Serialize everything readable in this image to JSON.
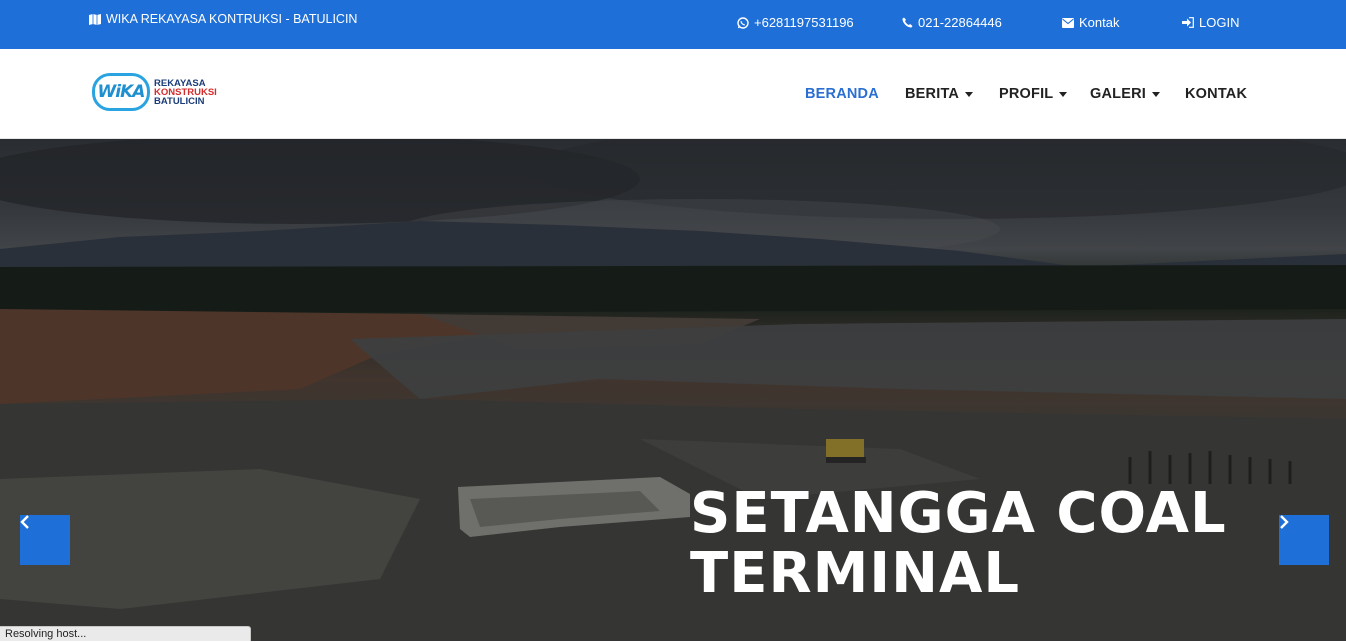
{
  "topbar": {
    "site_name": "WIKA REKAYASA KONTRUKSI - BATULICIN",
    "whatsapp": "+6281197531196",
    "phone": "021-22864446",
    "contact": "Kontak",
    "login": "LOGIN"
  },
  "logo": {
    "mark": "WiKA",
    "line1": "REKAYASA",
    "line2": "KONSTRUKSI",
    "line3": "BATULICIN"
  },
  "nav": {
    "items": [
      {
        "label": "BERANDA",
        "active": true
      },
      {
        "label": "BERITA",
        "dropdown": true
      },
      {
        "label": "PROFIL",
        "dropdown": true
      },
      {
        "label": "GALERI",
        "dropdown": true
      },
      {
        "label": "KONTAK"
      }
    ]
  },
  "hero": {
    "title_line1": "SETANGGA COAL",
    "title_line2": "TERMINAL"
  },
  "status_bar": {
    "text": "Resolving host..."
  },
  "colors": {
    "primary": "#1f6fd8",
    "nav_active": "#2a6fd1"
  }
}
